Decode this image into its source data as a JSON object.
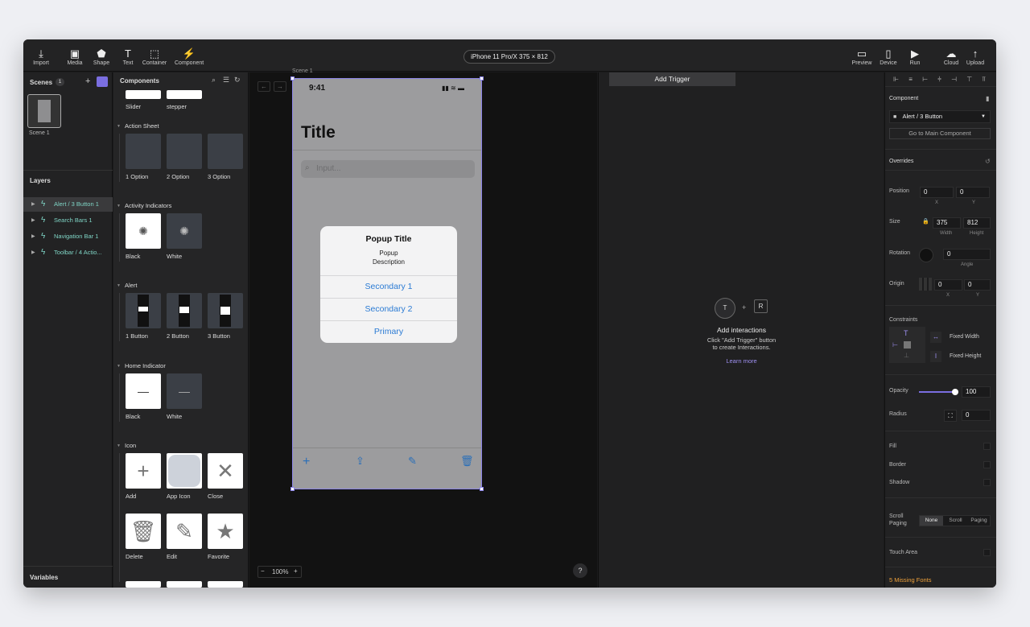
{
  "toolbar": {
    "import": "Import",
    "media": "Media",
    "shape": "Shape",
    "text": "Text",
    "container": "Container",
    "component": "Component",
    "device": "iPhone 11 Pro/X  375 × 812",
    "preview": "Preview",
    "device_btn": "Device",
    "run": "Run",
    "cloud": "Cloud",
    "upload": "Upload"
  },
  "scenes": {
    "title": "Scenes",
    "count": "1",
    "scene_label": "Scene 1"
  },
  "layers": {
    "title": "Layers",
    "items": [
      "Alert / 3 Button 1",
      "Search Bars 1",
      "Navigation Bar 1",
      "Toolbar / 4 Actio..."
    ]
  },
  "variables": "Variables",
  "components": {
    "title": "Components",
    "top_labels": [
      "Slider",
      "stepper"
    ],
    "sections": [
      {
        "name": "Action Sheet",
        "items": [
          "1 Option",
          "2 Option",
          "3 Option"
        ]
      },
      {
        "name": "Activity Indicators",
        "items": [
          "Black",
          "White"
        ]
      },
      {
        "name": "Alert",
        "items": [
          "1 Button",
          "2 Button",
          "3 Button"
        ]
      },
      {
        "name": "Home Indicator",
        "items": [
          "Black",
          "White"
        ]
      },
      {
        "name": "Icon",
        "items": [
          "Add",
          "App Icon",
          "Close",
          "Delete",
          "Edit",
          "Favorite"
        ]
      }
    ]
  },
  "canvas": {
    "scene_tag": "Scene 1",
    "time": "9:41",
    "title": "Title",
    "search_placeholder": "Input...",
    "popup": {
      "title": "Popup Title",
      "desc1": "Popup",
      "desc2": "Description",
      "buttons": [
        "Secondary 1",
        "Secondary 2",
        "Primary"
      ]
    },
    "zoom": "100%",
    "help": "?"
  },
  "interactions": {
    "add_trigger": "Add Trigger",
    "heading": "Add interactions",
    "line1": "Click \"Add Trigger\" button",
    "line2": "to create Interactions.",
    "learn": "Learn more",
    "key_t": "T",
    "key_r": "R",
    "plus": "+"
  },
  "props": {
    "component_label": "Component",
    "component_value": "Alert / 3 Button",
    "go_main": "Go to Main Component",
    "overrides": "Overrides",
    "position": "Position",
    "pos_x": "0",
    "pos_y": "0",
    "x": "X",
    "y": "Y",
    "size": "Size",
    "width": "375",
    "height": "812",
    "width_lbl": "Width",
    "height_lbl": "Height",
    "rotation": "Rotation",
    "angle": "0",
    "angle_lbl": "Angle",
    "origin": "Origin",
    "origin_x": "0",
    "origin_y": "0",
    "constraints": "Constraints",
    "fixed_width": "Fixed Width",
    "fixed_height": "Fixed Height",
    "opacity": "Opacity",
    "opacity_val": "100",
    "radius": "Radius",
    "radius_val": "0",
    "fill": "Fill",
    "border": "Border",
    "shadow": "Shadow",
    "scroll": "Scroll",
    "paging": "Paging",
    "scroll_opts": [
      "None",
      "Scroll",
      "Paging"
    ],
    "touch": "Touch Area",
    "missing": "5 Missing Fonts"
  },
  "colors": {
    "accent": "#8c85e8",
    "layer_text": "#7fd4c5",
    "link_blue": "#2b7bd4",
    "warning": "#f0a23b"
  }
}
